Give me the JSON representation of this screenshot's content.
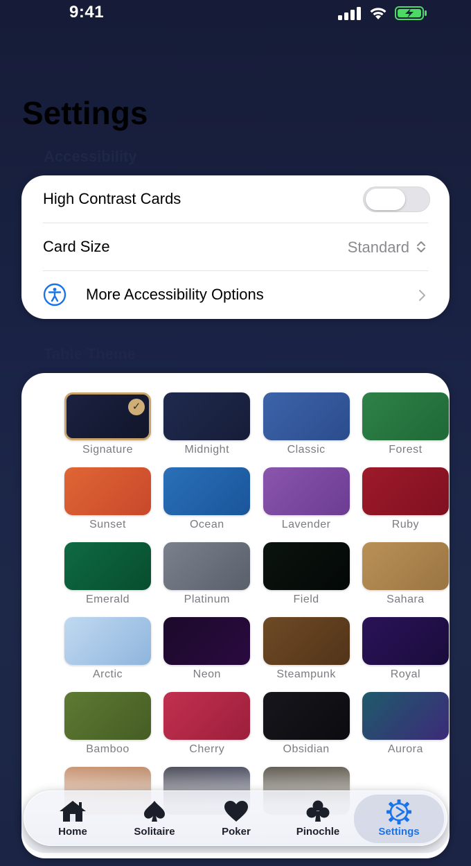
{
  "status_bar": {
    "time": "9:41"
  },
  "page": {
    "title": "Settings"
  },
  "accessibility": {
    "header": "Accessibility",
    "high_contrast_label": "High Contrast Cards",
    "high_contrast_on": false,
    "card_size_label": "Card Size",
    "card_size_value": "Standard",
    "more_options_label": "More Accessibility Options"
  },
  "table_theme": {
    "header": "Table Theme",
    "selected": "Signature",
    "themes": [
      {
        "name": "Signature",
        "from": "#1b2140",
        "to": "#11162b"
      },
      {
        "name": "Midnight",
        "from": "#1f2a4e",
        "to": "#161d38"
      },
      {
        "name": "Classic",
        "from": "#3d63a8",
        "to": "#2b4d8e"
      },
      {
        "name": "Forest",
        "from": "#2e8148",
        "to": "#1f6936"
      },
      {
        "name": "Sunset",
        "from": "#e06634",
        "to": "#c8482b"
      },
      {
        "name": "Ocean",
        "from": "#2a70b8",
        "to": "#1a559a"
      },
      {
        "name": "Lavender",
        "from": "#8a55ad",
        "to": "#6c3c93"
      },
      {
        "name": "Ruby",
        "from": "#9e1a2a",
        "to": "#7f1020"
      },
      {
        "name": "Emerald",
        "from": "#0f6a42",
        "to": "#074d2f"
      },
      {
        "name": "Platinum",
        "from": "#7a808c",
        "to": "#5a606b"
      },
      {
        "name": "Field",
        "from": "#0c140f",
        "to": "#030806"
      },
      {
        "name": "Sahara",
        "from": "#b99157",
        "to": "#9a7442"
      },
      {
        "name": "Arctic",
        "from": "#c0d9f0",
        "to": "#8fb5dd"
      },
      {
        "name": "Neon",
        "from": "#1c0a2a",
        "to": "#2a0a40"
      },
      {
        "name": "Steampunk",
        "from": "#6e4a25",
        "to": "#523419"
      },
      {
        "name": "Royal",
        "from": "#2a1358",
        "to": "#1a0c3c"
      },
      {
        "name": "Bamboo",
        "from": "#5e7a33",
        "to": "#455d24"
      },
      {
        "name": "Cherry",
        "from": "#c2304f",
        "to": "#9c1f3b"
      },
      {
        "name": "Obsidian",
        "from": "#16161c",
        "to": "#0b0b10"
      },
      {
        "name": "Aurora",
        "from": "#1f5a6b",
        "to": "#3c2a78"
      },
      {
        "name": "",
        "from": "#b87245",
        "to": "#a06035"
      },
      {
        "name": "",
        "from": "#0d1020",
        "to": "#1a1e3a"
      },
      {
        "name": "",
        "from": "#2a2418",
        "to": "#3b3220"
      }
    ]
  },
  "tab_bar": {
    "tabs": [
      {
        "label": "Home",
        "icon": "house-icon"
      },
      {
        "label": "Solitaire",
        "icon": "spade-icon"
      },
      {
        "label": "Poker",
        "icon": "heart-icon"
      },
      {
        "label": "Pinochle",
        "icon": "club-icon"
      },
      {
        "label": "Settings",
        "icon": "gear-icon"
      }
    ],
    "active": "Settings",
    "active_color": "#1a73e8"
  }
}
